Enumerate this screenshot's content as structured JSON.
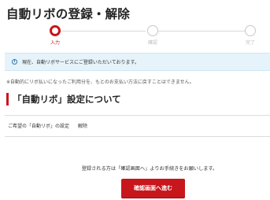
{
  "page": {
    "title": "自動リボの登録・解除"
  },
  "steps": [
    {
      "label": "入力",
      "state": "active"
    },
    {
      "label": "確認",
      "state": "inactive"
    },
    {
      "label": "完了",
      "state": "inactive"
    }
  ],
  "notice": {
    "icon": "info-icon",
    "text": "現在、自動リボサービスにご登録いただいております。"
  },
  "note": "※自動的にリボ払いになったご利用分を、もとのお支払い方法に戻すことはできません。",
  "section": {
    "title": "「自動リボ」設定について",
    "setting_label": "ご希望の「自動リボ」の設定",
    "setting_value": "解除"
  },
  "guide_text": "登録される方は「確認画面へ」よりお手続きをお願いします。",
  "confirm_button": "確認画面へ進む",
  "colors": {
    "accent": "#c8161d",
    "notice_bg": "#e6f3fa",
    "info_icon": "#2b78b5"
  }
}
